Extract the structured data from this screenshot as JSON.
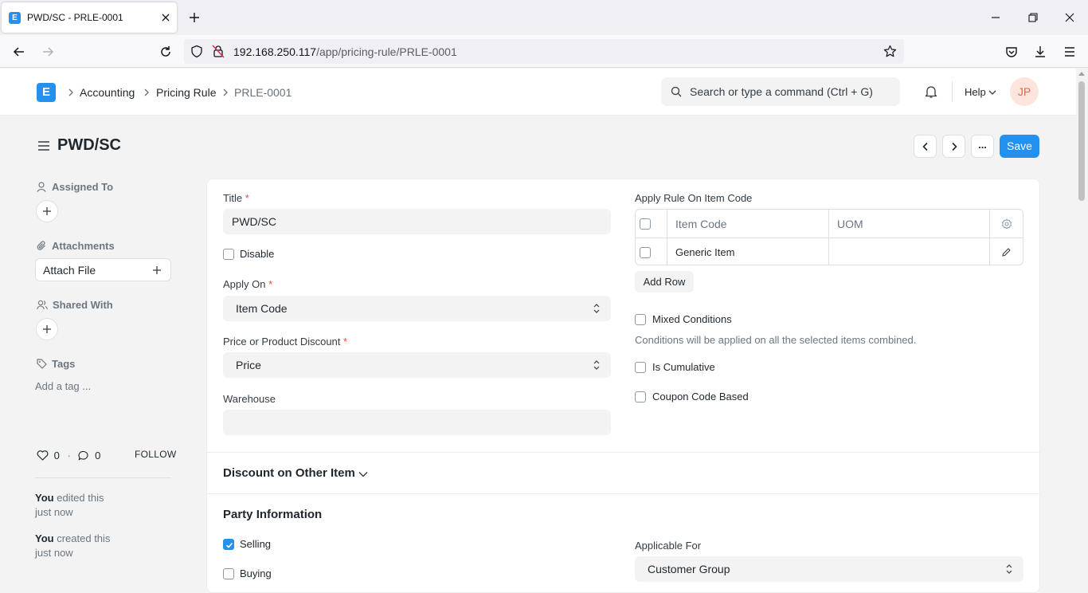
{
  "browser": {
    "tab_title": "PWD/SC - PRLE-0001",
    "favicon_letter": "E",
    "url_host": "192.168.250.117",
    "url_path": "/app/pricing-rule/PRLE-0001"
  },
  "header": {
    "logo_letter": "E",
    "breadcrumbs": [
      "Accounting",
      "Pricing Rule",
      "PRLE-0001"
    ],
    "search_placeholder": "Search or type a command (Ctrl + G)",
    "help_label": "Help",
    "avatar_initials": "JP"
  },
  "page": {
    "title": "PWD/SC",
    "save_label": "Save",
    "more_label": "..."
  },
  "sidebar": {
    "assigned_to": "Assigned To",
    "attachments": "Attachments",
    "attach_file": "Attach File",
    "shared_with": "Shared With",
    "tags": "Tags",
    "add_tag": "Add a tag ...",
    "likes_count": "0",
    "comments_count": "0",
    "follow": "FOLLOW",
    "activity": [
      {
        "actor": "You",
        "action": "edited this",
        "time": "just now"
      },
      {
        "actor": "You",
        "action": "created this",
        "time": "just now"
      }
    ]
  },
  "form": {
    "title_label": "Title",
    "title_value": "PWD/SC",
    "disable_label": "Disable",
    "apply_on_label": "Apply On",
    "apply_on_value": "Item Code",
    "price_discount_label": "Price or Product Discount",
    "price_discount_value": "Price",
    "warehouse_label": "Warehouse",
    "warehouse_value": "",
    "apply_rule_label": "Apply Rule On Item Code",
    "grid_headers": [
      "Item Code",
      "UOM"
    ],
    "grid_rows": [
      {
        "item_code": "Generic Item",
        "uom": ""
      }
    ],
    "add_row": "Add Row",
    "mixed_conditions": "Mixed Conditions",
    "mixed_desc": "Conditions will be applied on all the selected items combined.",
    "is_cumulative": "Is Cumulative",
    "coupon_code_based": "Coupon Code Based"
  },
  "sections": {
    "discount_other_item": "Discount on Other Item",
    "party_information": "Party Information",
    "selling": "Selling",
    "selling_checked": true,
    "buying": "Buying",
    "applicable_for_label": "Applicable For",
    "applicable_for_value": "Customer Group"
  },
  "colors": {
    "accent": "#2490ef",
    "required": "#e24c4c",
    "muted_text": "#6c7680"
  }
}
